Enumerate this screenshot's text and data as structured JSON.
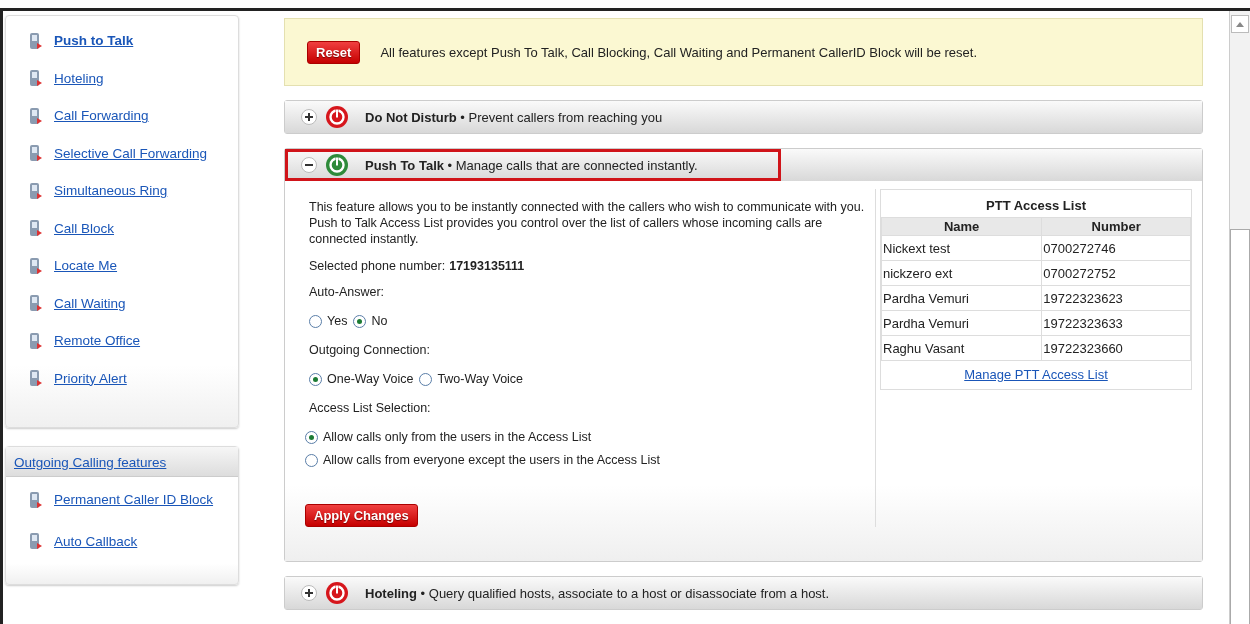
{
  "sidebar": {
    "groups": [
      {
        "items": [
          {
            "label": "Push to Talk",
            "selected": true
          },
          {
            "label": "Hoteling",
            "selected": false
          },
          {
            "label": "Call Forwarding",
            "selected": false
          },
          {
            "label": "Selective Call Forwarding",
            "selected": false
          },
          {
            "label": "Simultaneous Ring",
            "selected": false
          },
          {
            "label": "Call Block",
            "selected": false
          },
          {
            "label": "Locate Me",
            "selected": false
          },
          {
            "label": "Call Waiting",
            "selected": false
          },
          {
            "label": "Remote Office",
            "selected": false
          },
          {
            "label": "Priority Alert",
            "selected": false
          }
        ]
      },
      {
        "heading": "Outgoing Calling features",
        "items": [
          {
            "label": "Permanent Caller ID Block",
            "selected": false
          },
          {
            "label": "Auto Callback",
            "selected": false
          }
        ]
      }
    ]
  },
  "reset_notice": {
    "button": "Reset",
    "message": "All features except Push To Talk, Call Blocking, Call Waiting and Permanent CallerID Block will be reset."
  },
  "features": [
    {
      "title": "Do Not Disturb",
      "description": "• Prevent callers from reaching you",
      "on": false,
      "expanded": false,
      "highlighted": false
    },
    {
      "title": "Push To Talk",
      "description": "• Manage calls that are connected instantly.",
      "on": true,
      "expanded": true,
      "highlighted": true,
      "detail": {
        "intro": "This feature allows you to be instantly connected with the callers who wish to communicate with you. Push to Talk Access List provides you control over the list of callers whose incoming calls are connected instantly.",
        "phone_label": "Selected phone number:",
        "phone_number": "17193135111",
        "groups": [
          {
            "label": "Auto-Answer:",
            "kind": "inline",
            "options": [
              {
                "label": "Yes",
                "selected": false
              },
              {
                "label": "No",
                "selected": true
              }
            ]
          },
          {
            "label": "Outgoing Connection:",
            "kind": "inline",
            "options": [
              {
                "label": "One-Way Voice",
                "selected": true
              },
              {
                "label": "Two-Way Voice",
                "selected": false
              }
            ]
          },
          {
            "label": "Access List Selection:",
            "kind": "stacked",
            "options": [
              {
                "label": "Allow calls only from the users in the Access List",
                "selected": true
              },
              {
                "label": "Allow calls from everyone except the users in the Access List",
                "selected": false
              }
            ]
          }
        ],
        "apply_button": "Apply Changes",
        "access_list": {
          "title": "PTT Access List",
          "columns": [
            "Name",
            "Number"
          ],
          "rows": [
            [
              "Nickext test",
              "0700272746"
            ],
            [
              "nickzero ext",
              "0700272752"
            ],
            [
              "Pardha Vemuri",
              "19722323623"
            ],
            [
              "Pardha Vemuri",
              "19722323633"
            ],
            [
              "Raghu Vasant",
              "19722323660"
            ]
          ],
          "link": "Manage PTT Access List"
        }
      }
    },
    {
      "title": "Hoteling",
      "description": "• Query qualified hosts, associate to a host or disassociate from a host.",
      "on": false,
      "expanded": false,
      "highlighted": false
    }
  ]
}
